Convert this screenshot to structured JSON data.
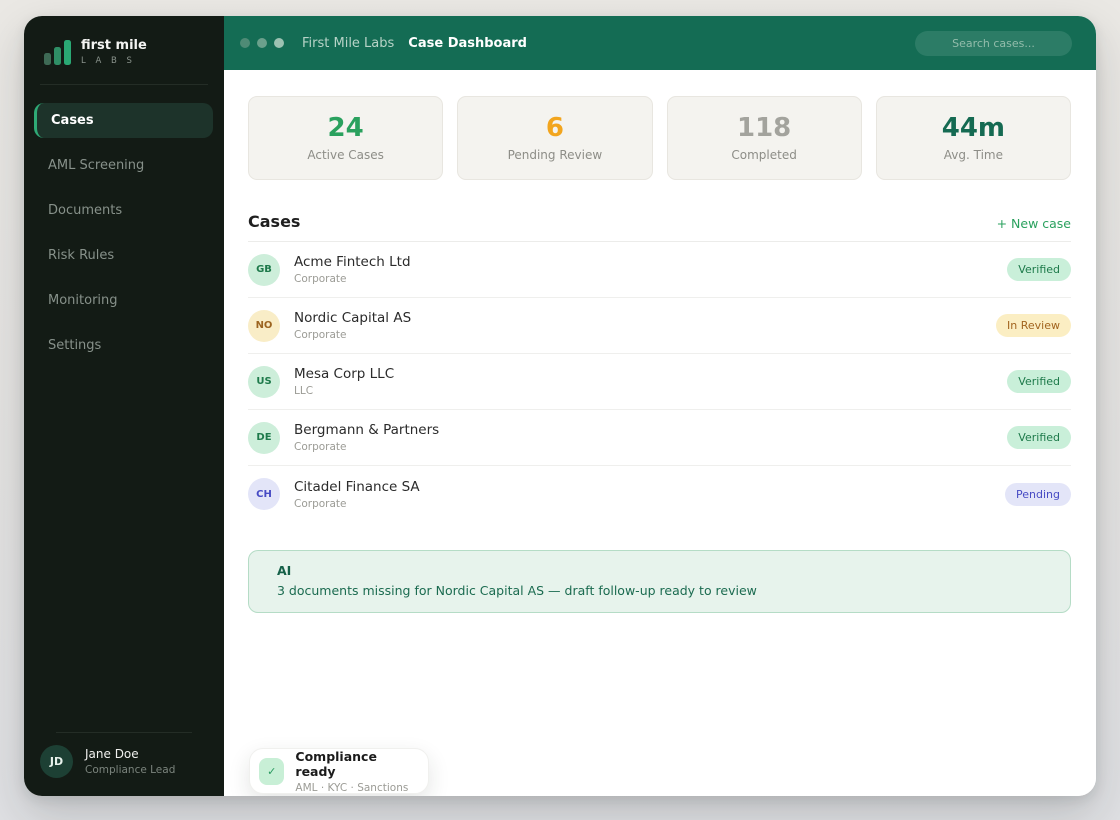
{
  "sidebar": {
    "logo": {
      "title": "first mile",
      "subtitle": "L A B S"
    },
    "nav": [
      {
        "label": "Cases",
        "active": true
      },
      {
        "label": "AML Screening",
        "active": false
      },
      {
        "label": "Documents",
        "active": false
      },
      {
        "label": "Risk Rules",
        "active": false
      },
      {
        "label": "Monitoring",
        "active": false
      },
      {
        "label": "Settings",
        "active": false
      }
    ],
    "user": {
      "initials": "JD",
      "name": "Jane Doe",
      "role": "Compliance Lead"
    }
  },
  "header": {
    "app_name": "First Mile Labs",
    "page_title": "Case Dashboard",
    "search_placeholder": "Search cases...",
    "dots": [
      {
        "color": "#4f8b76"
      },
      {
        "color": "#6ba08c"
      },
      {
        "color": "#9cc2b2"
      }
    ]
  },
  "stats": [
    {
      "value": "24",
      "label": "Active Cases",
      "color": "#2aa15e"
    },
    {
      "value": "6",
      "label": "Pending Review",
      "color": "#f2a51e"
    },
    {
      "value": "118",
      "label": "Completed",
      "color": "#a3a39d"
    },
    {
      "value": "44m",
      "label": "Avg. Time",
      "color": "#156a52"
    }
  ],
  "cases": {
    "title": "Cases",
    "new_case_label": "+ New case",
    "rows": [
      {
        "initials": "GB",
        "name": "Acme Fintech Ltd",
        "type": "Corporate",
        "status": "Verified",
        "variant": "green"
      },
      {
        "initials": "NO",
        "name": "Nordic Capital AS",
        "type": "Corporate",
        "status": "In Review",
        "variant": "yellow"
      },
      {
        "initials": "US",
        "name": "Mesa Corp LLC",
        "type": "LLC",
        "status": "Verified",
        "variant": "green"
      },
      {
        "initials": "DE",
        "name": "Bergmann & Partners",
        "type": "Corporate",
        "status": "Verified",
        "variant": "green"
      },
      {
        "initials": "CH",
        "name": "Citadel Finance SA",
        "type": "Corporate",
        "status": "Pending",
        "variant": "indigo"
      }
    ]
  },
  "ai_banner": {
    "label": "AI",
    "message": "3 documents missing for Nordic Capital AS — draft follow-up ready to review"
  },
  "compliance_card": {
    "check_icon": "✓",
    "title": "Compliance ready",
    "subtitle": "AML · KYC · Sanctions"
  },
  "colors": {
    "brand_green": "#146c54",
    "accent_green": "#2aa974",
    "sidebar_bg": "#131b15"
  }
}
